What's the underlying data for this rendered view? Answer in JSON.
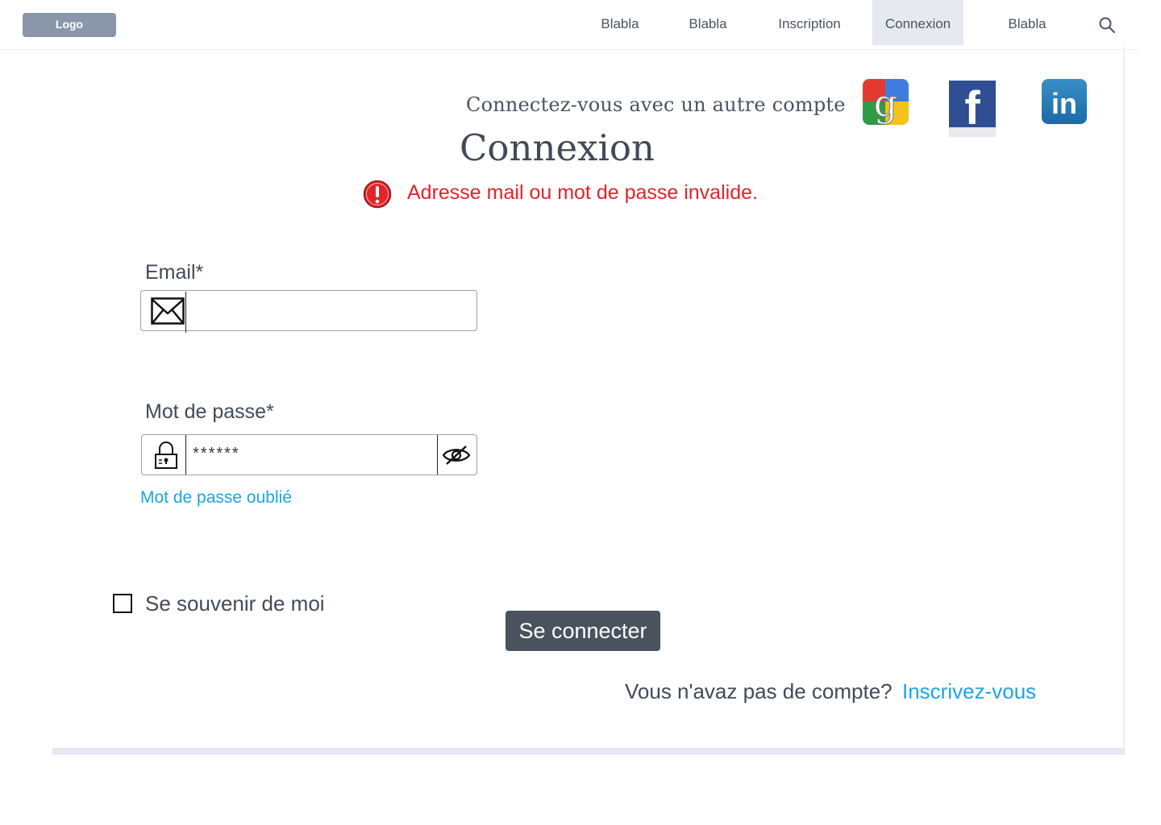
{
  "header": {
    "logo": "Logo",
    "nav": [
      {
        "label": "Blabla"
      },
      {
        "label": "Blabla"
      },
      {
        "label": "Inscription"
      },
      {
        "label": "Connexion",
        "active": true
      },
      {
        "label": "Blabla"
      }
    ],
    "search_icon": "search-icon"
  },
  "social": {
    "prompt": "Connectez-vous avec un autre compte",
    "providers": [
      {
        "icon": "google-icon",
        "letter": "g"
      },
      {
        "icon": "facebook-icon",
        "letter": "f"
      },
      {
        "icon": "linkedin-icon",
        "letter": "in"
      }
    ]
  },
  "title": "Connexion",
  "error": {
    "icon": "error-icon",
    "message": "Adresse mail ou mot de passe invalide.",
    "color": "#e0242a"
  },
  "form": {
    "email_label": "Email*",
    "email_value": "",
    "password_label": "Mot de passe*",
    "password_value": "******",
    "forgot_link": "Mot de passe oublié",
    "remember_label": "Se souvenir de moi",
    "remember_checked": false,
    "submit_label": "Se connecter"
  },
  "footer": {
    "no_account": "Vous n'avaz pas de compte?",
    "signup_link": "Inscrivez-vous"
  },
  "colors": {
    "link": "#1aa5e6",
    "button": "#4a525d",
    "active_nav": "#e6e9f0"
  }
}
